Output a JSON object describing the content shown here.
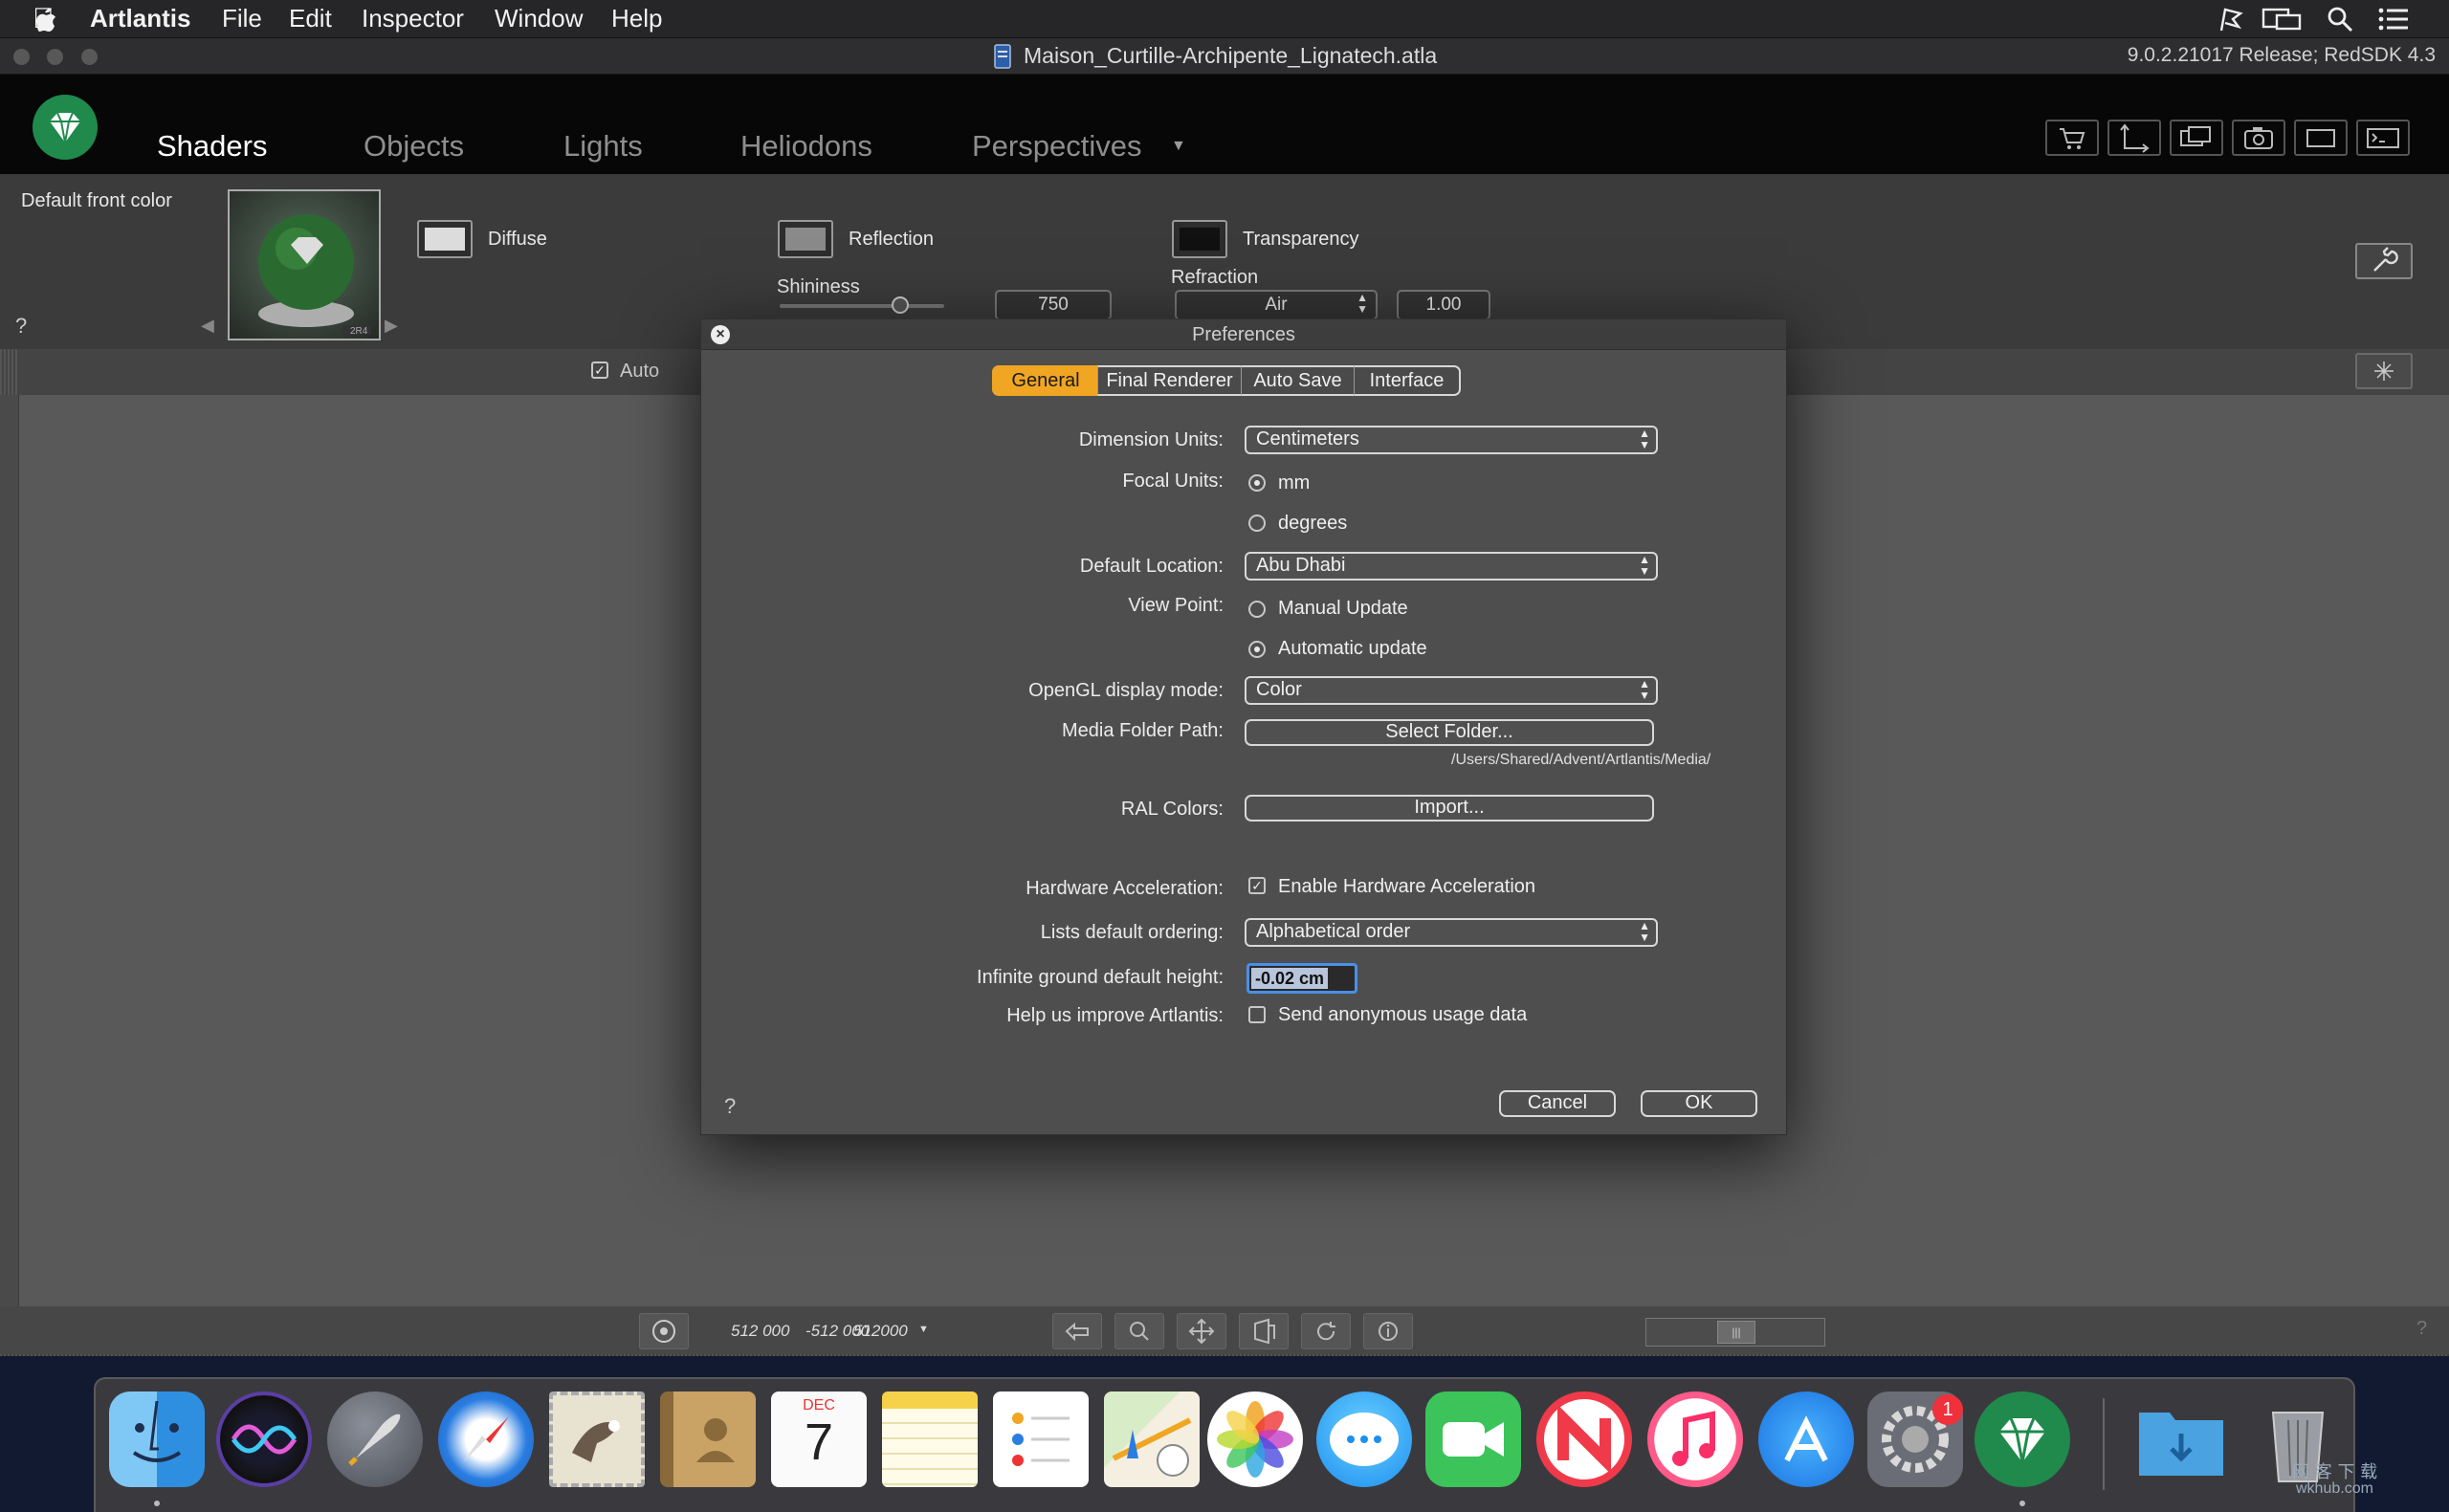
{
  "menubar": {
    "app": "Artlantis",
    "items": [
      "File",
      "Edit",
      "Inspector",
      "Window",
      "Help"
    ]
  },
  "window": {
    "title": "Maison_Curtille-Archipente_Lignatech.atla",
    "version": "9.0.2.21017 Release; RedSDK 4.3"
  },
  "tabs": [
    "Shaders",
    "Objects",
    "Lights",
    "Heliodons",
    "Perspectives"
  ],
  "active_tab": "Shaders",
  "toolbar_icons": [
    "cart-icon",
    "axes-icon",
    "window-icon",
    "camera-icon",
    "crop-icon",
    "console-icon"
  ],
  "inspector": {
    "title": "Default front color",
    "diffuse": "Diffuse",
    "reflection": "Reflection",
    "transparency": "Transparency",
    "shininess_label": "Shininess",
    "shininess_value": "750",
    "refraction_label": "Refraction",
    "refraction_select": "Air",
    "refraction_value": "1.00",
    "help": "?",
    "thumb_text": "2R4",
    "auto": "Auto"
  },
  "bottom": {
    "coords": "512 000",
    "coords2": "-512 000",
    "coords3": "512000",
    "help": "?"
  },
  "colors": {
    "accent": "#f0a623",
    "brand_green": "#1f8a4c"
  },
  "dialog": {
    "title": "Preferences",
    "tabs": [
      "General",
      "Final Renderer",
      "Auto Save",
      "Interface"
    ],
    "active_tab": "General",
    "dimension_units_label": "Dimension Units:",
    "dimension_units_value": "Centimeters",
    "focal_units_label": "Focal Units:",
    "focal_mm": "mm",
    "focal_degrees": "degrees",
    "default_location_label": "Default Location:",
    "default_location_value": "Abu Dhabi",
    "view_point_label": "View Point:",
    "manual_update": "Manual Update",
    "automatic_update": "Automatic update",
    "opengl_label": "OpenGL display mode:",
    "opengl_value": "Color",
    "media_folder_label": "Media Folder Path:",
    "select_folder": "Select Folder...",
    "media_path": "/Users/Shared/Advent/Artlantis/Media/",
    "ral_label": "RAL Colors:",
    "import": "Import...",
    "hw_label": "Hardware Acceleration:",
    "hw_option": "Enable Hardware Acceleration",
    "lists_label": "Lists default ordering:",
    "lists_value": "Alphabetical order",
    "ground_label": "Infinite ground default height:",
    "ground_value": "-0.02 cm",
    "improve_label": "Help us improve Artlantis:",
    "improve_option": "Send anonymous usage data",
    "help": "?",
    "cancel": "Cancel",
    "ok": "OK"
  },
  "dock": {
    "calendar_month": "DEC",
    "calendar_day": "7",
    "prefs_badge": "1",
    "watermark_top": "网 客 下 载",
    "watermark_bottom": "wkhub.com"
  }
}
